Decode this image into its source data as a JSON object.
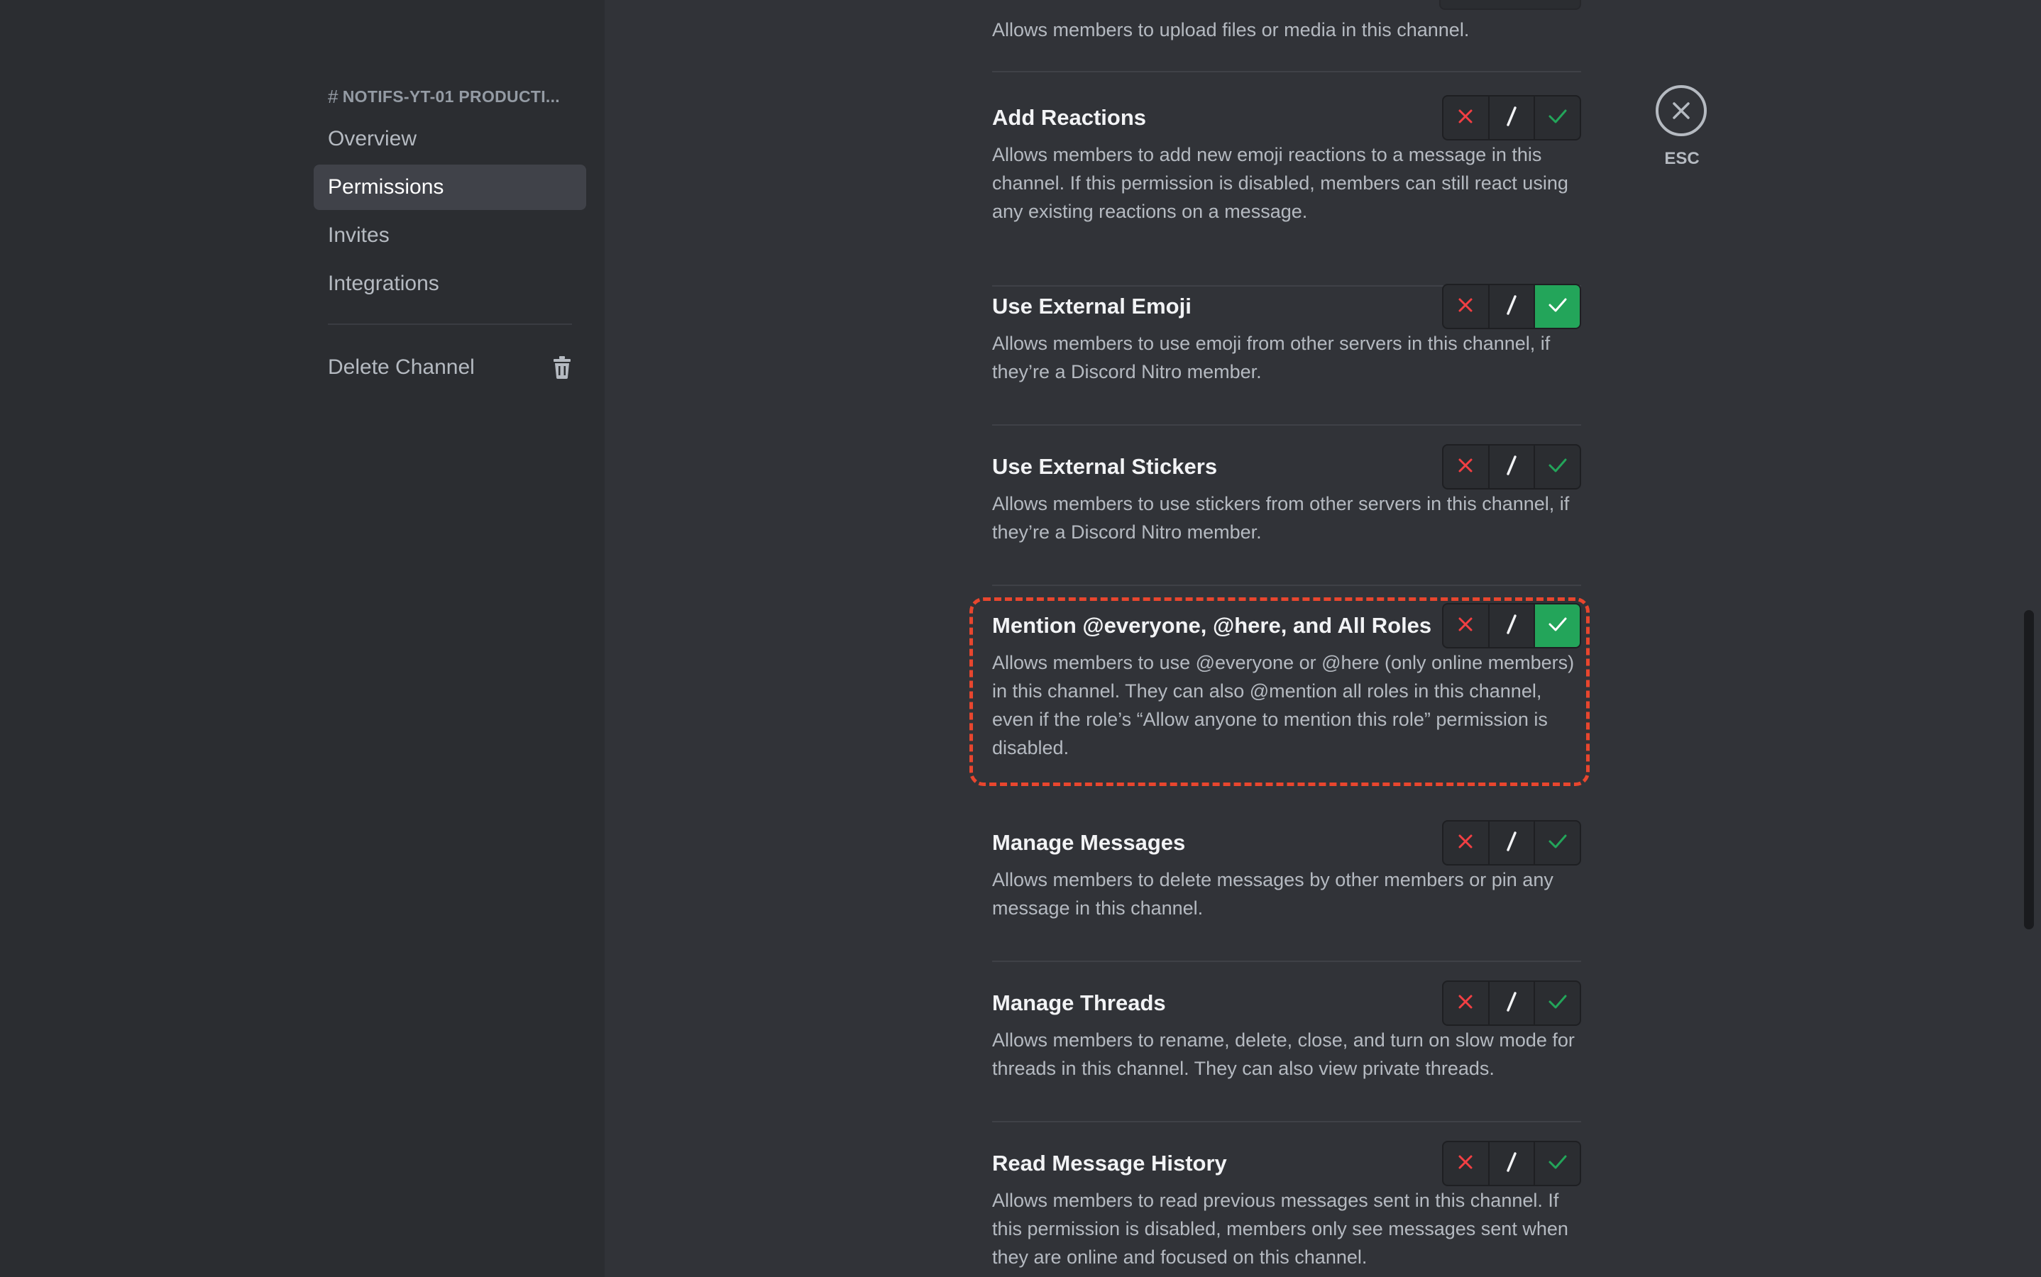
{
  "sidebar": {
    "channel_name": "NOTIFS-YT-01 PRODUCTI...",
    "items": [
      {
        "label": "Overview"
      },
      {
        "label": "Permissions"
      },
      {
        "label": "Invites"
      },
      {
        "label": "Integrations"
      }
    ],
    "delete_label": "Delete Channel"
  },
  "close": {
    "esc_label": "ESC"
  },
  "top_partial": {
    "desc": "Allows members to upload files or media in this channel."
  },
  "permissions": [
    {
      "title": "Add Reactions",
      "desc": "Allows members to add new emoji reactions to a message in this channel. If this permission is disabled, members can still react using any existing reactions on a message.",
      "state": "neutral"
    },
    {
      "title": "Use External Emoji",
      "desc": "Allows members to use emoji from other servers in this channel, if they’re a Discord Nitro member.",
      "state": "allow"
    },
    {
      "title": "Use External Stickers",
      "desc": "Allows members to use stickers from other servers in this channel, if they’re a Discord Nitro member.",
      "state": "neutral"
    },
    {
      "title": "Mention @everyone, @here, and All Roles",
      "desc": "Allows members to use @everyone or @here (only online members) in this channel. They can also @mention all roles in this channel, even if the role’s “Allow anyone to mention this role” permission is disabled.",
      "state": "allow"
    },
    {
      "title": "Manage Messages",
      "desc": "Allows members to delete messages by other members or pin any message in this channel.",
      "state": "neutral"
    },
    {
      "title": "Manage Threads",
      "desc": "Allows members to rename, delete, close, and turn on slow mode for threads in this channel. They can also view private threads.",
      "state": "neutral"
    },
    {
      "title": "Read Message History",
      "desc": "Allows members to read previous messages sent in this channel. If this permission is disabled, members only see messages sent when they are online and focused on this channel.",
      "state": "neutral"
    }
  ],
  "colors": {
    "deny": "#f23f43",
    "allow": "#23a55a",
    "highlight": "#e8462e"
  }
}
